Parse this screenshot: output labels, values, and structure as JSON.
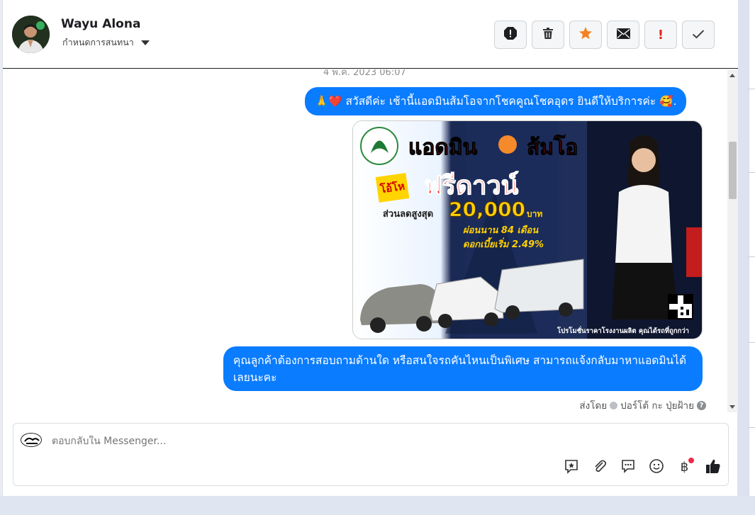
{
  "header": {
    "contact_name": "Wayu Alona",
    "assign_label": "กำหนดการสนทนา",
    "actions": [
      {
        "name": "report-icon"
      },
      {
        "name": "trash-icon"
      },
      {
        "name": "star-icon"
      },
      {
        "name": "mail-icon"
      },
      {
        "name": "priority-icon",
        "label": "!"
      },
      {
        "name": "done-icon"
      }
    ]
  },
  "thread": {
    "timestamp": "4 พ.ค. 2023 06:07",
    "message1": "🙏❤️ สวัสดีค่ะ เช้านี้แอดมินส้มโอจากโชคคูณโชคอุดร ยินดีให้บริการค่ะ 🥰.",
    "promo": {
      "headline": "แอดมิน",
      "headline_name": "ส้มโอ",
      "badge": "โอ้โห",
      "offer": "ฟรีดาวน์",
      "discount_label": "ส่วนลดสูงสุด",
      "discount_value": "20,000",
      "discount_unit": "บาท",
      "installment": "ผ่อนนาน 84 เดือน",
      "interest": "ดอกเบี้ยเริ่ม 2.49%",
      "footer": "โปรโมชั่นราคาโรงงานผลิต คุณได้รถที่ถูกกว่า"
    },
    "message2": "คุณลูกค้าต้องการสอบถามด้านใด หรือสนใจรถคันไหนเป็นพิเศษ สามารถแจ้งกลับมาหาแอดมินได้เลยนะคะ",
    "sent_by_label": "ส่งโดย",
    "sent_by_name": "ปอร์โต้ กะ ปุ่ยฝ้าย",
    "sent_by_help": "?"
  },
  "composer": {
    "placeholder": "ตอบกลับใน Messenger...",
    "tools": [
      "saved-reply-icon",
      "attach-icon",
      "chat-icon",
      "emoji-icon",
      "baht-icon",
      "like-icon"
    ],
    "baht_symbol": "฿"
  },
  "colors": {
    "bubble": "#0a7cff",
    "star": "#f58220",
    "priority": "#e02424"
  }
}
